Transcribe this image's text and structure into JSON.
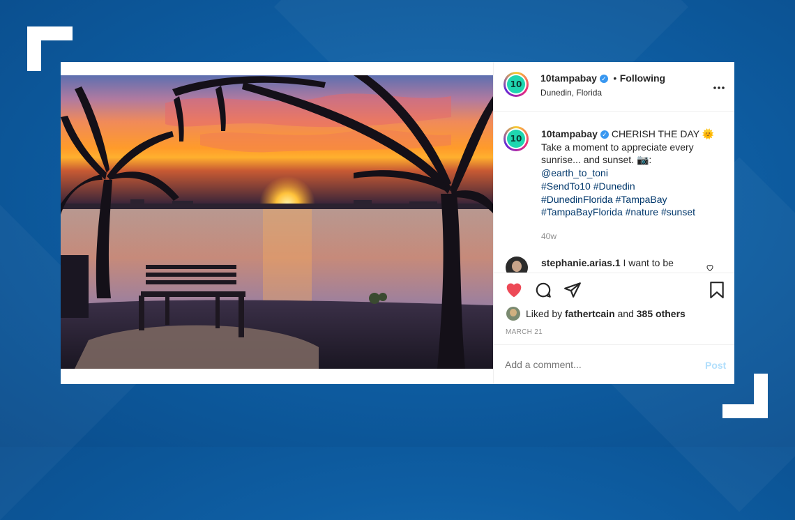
{
  "colors": {
    "background": "#0e5ea3",
    "like_red": "#ed4956",
    "link_blue": "#00376b",
    "verified_blue": "#3897f0",
    "muted": "#8e8e8e",
    "post_disabled": "#b2dffc"
  },
  "post": {
    "header": {
      "username": "10tampabay",
      "separator": "•",
      "follow_status": "Following",
      "location": "Dunedin, Florida",
      "avatar_text": "10",
      "more_icon": "more-dots-icon"
    },
    "caption": {
      "username": "10tampabay",
      "text_1": "CHERISH THE DAY",
      "emoji_sun": "🌞",
      "line_2": "Take a moment to appreciate every",
      "line_3a": "sunrise... and sunset.",
      "emoji_camera": "📷",
      "line_3b": ":",
      "mention": "@earth_to_toni",
      "tags_line_1": "#SendTo10 #Dunedin",
      "tags_line_2": "#DunedinFlorida #TampaBay",
      "tags_line_3": "#TampaBayFlorida #nature #sunset",
      "age": "40w"
    },
    "comment": {
      "username": "stephanie.arias.1",
      "text": "I want to be"
    },
    "actions": {
      "like_icon": "heart-filled-icon",
      "comment_icon": "comment-icon",
      "share_icon": "share-icon",
      "save_icon": "bookmark-icon"
    },
    "likes": {
      "prefix": "Liked by",
      "user": "fathertcain",
      "middle": "and",
      "others": "385 others"
    },
    "date": "MARCH 21",
    "add_comment": {
      "placeholder": "Add a comment...",
      "post_label": "Post"
    }
  }
}
